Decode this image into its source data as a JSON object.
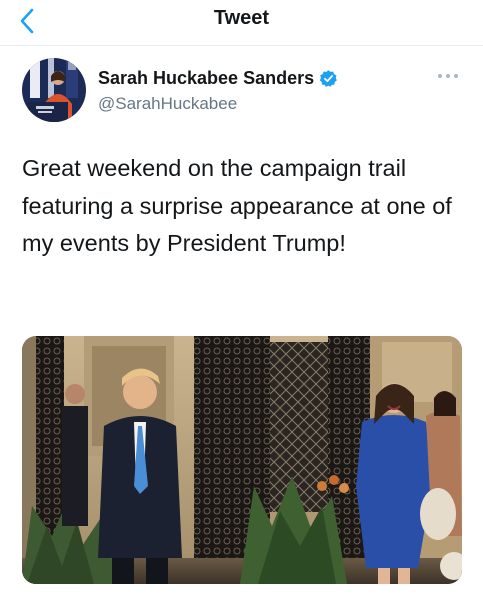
{
  "header": {
    "title": "Tweet",
    "back_icon": "chevron-left-icon",
    "accent_color": "#1da1f2"
  },
  "tweet": {
    "author": {
      "display_name": "Sarah Huckabee Sanders",
      "handle": "@SarahHuckabee",
      "verified": true,
      "verified_icon": "verified-badge-icon",
      "avatar_icon": "avatar"
    },
    "more_icon": "more-options-icon",
    "text": "Great weekend on the campaign trail featuring a surprise appearance at one of my events by President Trump!",
    "media": {
      "kind": "photo"
    }
  },
  "colors": {
    "text_primary": "#14171a",
    "text_secondary": "#657786",
    "divider": "#e6ecf0",
    "verified_blue": "#1da1f2"
  }
}
